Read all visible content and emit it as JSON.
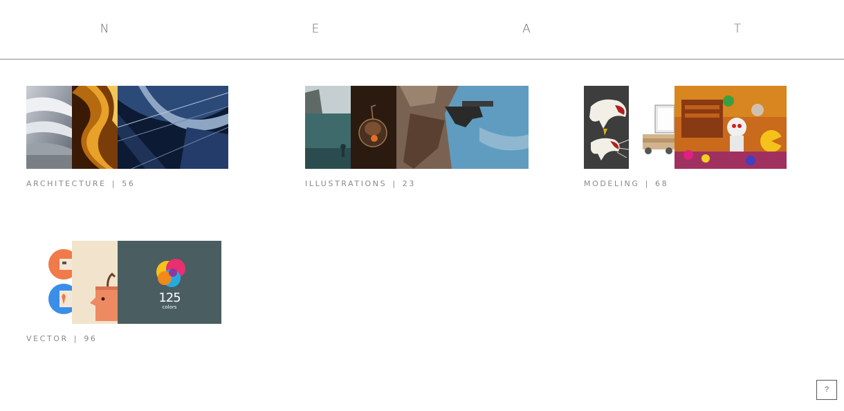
{
  "header": {
    "logo_letters": [
      "N",
      "E",
      "A",
      "T"
    ]
  },
  "categories": [
    {
      "name": "ARCHITECTURE",
      "count": "56"
    },
    {
      "name": "ILLUSTRATIONS",
      "count": "23"
    },
    {
      "name": "MODELING",
      "count": "68"
    },
    {
      "name": "VECTOR",
      "count": "96"
    }
  ],
  "separator": "|",
  "vector_thumb_text": {
    "number": "125",
    "word": "colors"
  },
  "help": {
    "label": "?"
  },
  "colors": {
    "header_rule": "#8a8a8a",
    "caption": "#888888",
    "vector_bg": "#4a5d61"
  }
}
